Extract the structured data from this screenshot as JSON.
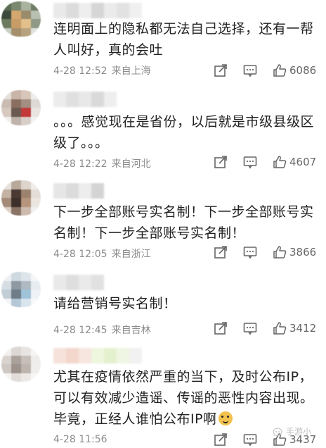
{
  "comments": [
    {
      "text": "连明面上的隐私都无法自己选择，还有一帮人叫好，真的会吐",
      "date": "4-28 12:52",
      "location": "来自上海",
      "likes": "6086"
    },
    {
      "text": "。。。感觉现在是省份，以后就是市级县级区级了。。。",
      "date": "4-28 12:22",
      "location": "来自河北",
      "likes": "4607"
    },
    {
      "text": "下一步全部账号实名制！下一步全部账号实名制！下一步全部账号实名制！",
      "date": "4-28 12:05",
      "location": "来自浙江",
      "likes": "3866"
    },
    {
      "text": "请给营销号实名制！",
      "date": "4-28 12:45",
      "location": "来自吉林",
      "likes": "3412"
    },
    {
      "text": "尤其在疫情依然严重的当下，及时公布IP，可以有效减少造谣、传谣的恶性内容出现。毕竟，正经人谁怕公布IP啊",
      "date": "4-28 11:56",
      "location": "",
      "likes": "3437"
    }
  ],
  "icons": {
    "repost": "share-icon",
    "comment": "comment-icon",
    "like": "thumbs-up-icon",
    "emoji": "doge-emoji-icon"
  },
  "watermark": "手游小"
}
